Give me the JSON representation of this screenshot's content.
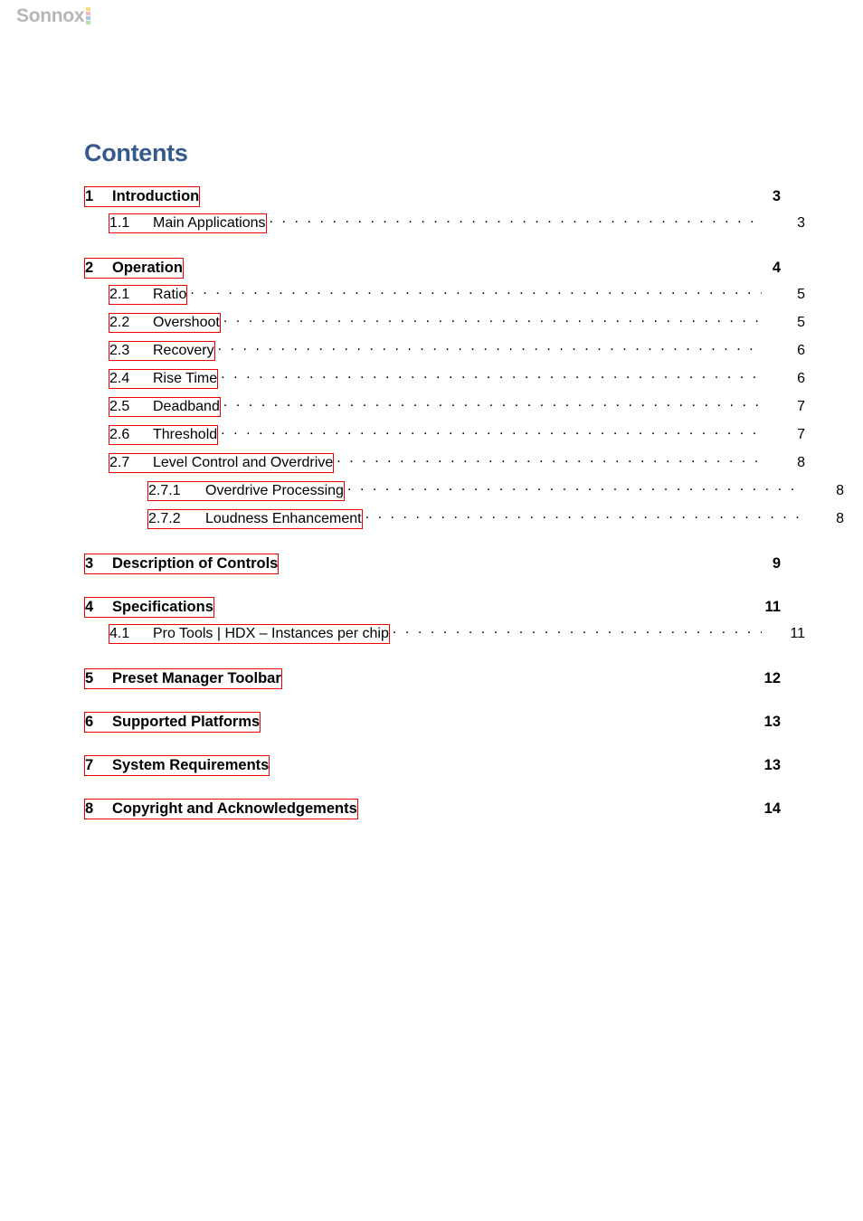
{
  "logo": {
    "text": "Sonnox",
    "text_color": "#b7b7b7",
    "dot_colors": [
      "#f4e07a",
      "#f2b6bc",
      "#a8c6e8",
      "#b9dca8"
    ]
  },
  "heading": {
    "title": "Contents",
    "color": "#35598c"
  },
  "link_box_color": "#ee0000",
  "toc": {
    "entries": [
      {
        "level": 1,
        "number": "1",
        "title": "Introduction",
        "page": "3",
        "leader": false,
        "gap_before": false
      },
      {
        "level": 2,
        "number": "1.1",
        "title": "Main Applications",
        "page": "3",
        "leader": true,
        "gap_before": false
      },
      {
        "level": 1,
        "number": "2",
        "title": "Operation",
        "page": "4",
        "leader": false,
        "gap_before": true
      },
      {
        "level": 2,
        "number": "2.1",
        "title": "Ratio",
        "page": "5",
        "leader": true,
        "gap_before": false
      },
      {
        "level": 2,
        "number": "2.2",
        "title": "Overshoot",
        "page": "5",
        "leader": true,
        "gap_before": false
      },
      {
        "level": 2,
        "number": "2.3",
        "title": "Recovery",
        "page": "6",
        "leader": true,
        "gap_before": false
      },
      {
        "level": 2,
        "number": "2.4",
        "title": "Rise Time",
        "page": "6",
        "leader": true,
        "gap_before": false
      },
      {
        "level": 2,
        "number": "2.5",
        "title": "Deadband",
        "page": "7",
        "leader": true,
        "gap_before": false
      },
      {
        "level": 2,
        "number": "2.6",
        "title": "Threshold",
        "page": "7",
        "leader": true,
        "gap_before": false
      },
      {
        "level": 2,
        "number": "2.7",
        "title": "Level Control and Overdrive",
        "page": "8",
        "leader": true,
        "gap_before": false
      },
      {
        "level": 3,
        "number": "2.7.1",
        "title": "Overdrive Processing",
        "page": "8",
        "leader": true,
        "gap_before": false
      },
      {
        "level": 3,
        "number": "2.7.2",
        "title": "Loudness Enhancement",
        "page": "8",
        "leader": true,
        "gap_before": false
      },
      {
        "level": 1,
        "number": "3",
        "title": "Description of Controls",
        "page": "9",
        "leader": false,
        "gap_before": true
      },
      {
        "level": 1,
        "number": "4",
        "title": "Specifications",
        "page": "11",
        "leader": false,
        "gap_before": true
      },
      {
        "level": 2,
        "number": "4.1",
        "title": "Pro Tools | HDX – Instances per chip",
        "page": "11",
        "leader": true,
        "gap_before": false
      },
      {
        "level": 1,
        "number": "5",
        "title": "Preset Manager Toolbar",
        "page": "12",
        "leader": false,
        "gap_before": true
      },
      {
        "level": 1,
        "number": "6",
        "title": "Supported Platforms",
        "page": "13",
        "leader": false,
        "gap_before": true
      },
      {
        "level": 1,
        "number": "7",
        "title": "System Requirements",
        "page": "13",
        "leader": false,
        "gap_before": true
      },
      {
        "level": 1,
        "number": "8",
        "title": "Copyright and Acknowledgements",
        "page": "14",
        "leader": false,
        "gap_before": true
      }
    ]
  }
}
